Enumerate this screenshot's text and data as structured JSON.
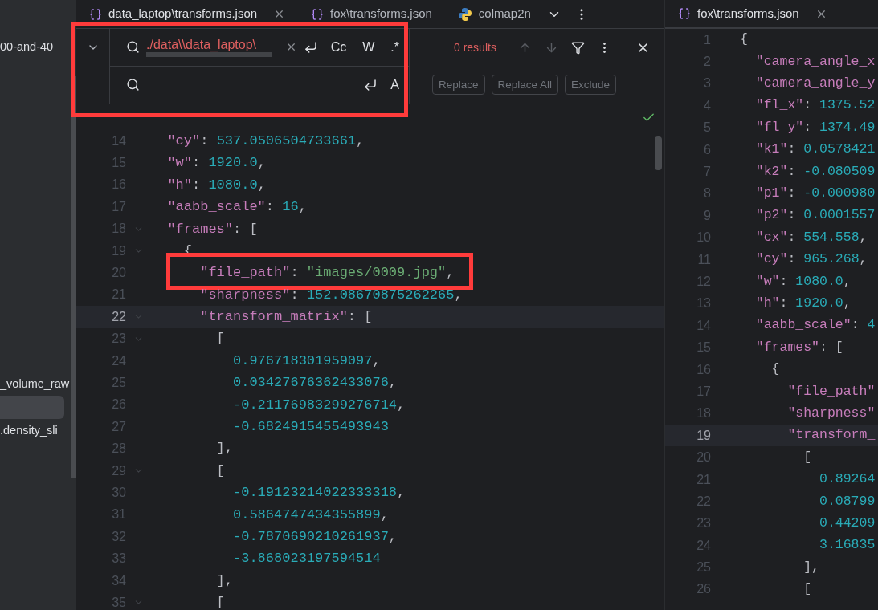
{
  "sidebar": {
    "items": [
      {
        "kind": "text",
        "text": "00-and-40",
        "selected": false
      },
      {
        "kind": "text",
        "text": "_volume_raw",
        "selected": false
      },
      {
        "kind": "blank",
        "selected": true
      },
      {
        "kind": "text",
        "text": ".density_sli",
        "selected": false
      }
    ]
  },
  "left_editor": {
    "tabs": [
      {
        "label": "data_laptop\\transforms.json",
        "kind": "json",
        "selected": true,
        "closable": true
      },
      {
        "label": "fox\\transforms.json",
        "kind": "json",
        "selected": false,
        "closable": false
      },
      {
        "label": "colmap2n",
        "kind": "python",
        "selected": false,
        "closable": false
      }
    ],
    "find_panel": {
      "highlighted": true,
      "expanded": false,
      "query": "./data\\\\data_laptop\\",
      "query_error": true,
      "toggles": [
        {
          "text": "Cc",
          "selected": false
        },
        {
          "text": "W",
          "selected": false
        },
        {
          "text": ".*",
          "selected": false
        }
      ],
      "result_count": "0 results",
      "result_error": true,
      "navigation_disabled": true,
      "replace_toggles": [
        {
          "text": "A",
          "selected": false
        }
      ],
      "buttons": [
        {
          "label": "Replace",
          "disabled": true
        },
        {
          "label": "Replace All",
          "disabled": true
        },
        {
          "label": "Exclude",
          "disabled": true
        }
      ]
    },
    "inspection_ok": true,
    "lines": [
      {
        "number": "14",
        "current": false,
        "fold": false,
        "highlighted": false,
        "tokens": [
          {
            "kind": "key",
            "text": "  \"cy\""
          },
          {
            "kind": "punct",
            "text": ": "
          },
          {
            "kind": "number",
            "text": "537.0506504733661"
          },
          {
            "kind": "punct",
            "text": ","
          }
        ]
      },
      {
        "number": "15",
        "current": false,
        "fold": false,
        "highlighted": false,
        "tokens": [
          {
            "kind": "key",
            "text": "  \"w\""
          },
          {
            "kind": "punct",
            "text": ": "
          },
          {
            "kind": "number",
            "text": "1920.0"
          },
          {
            "kind": "punct",
            "text": ","
          }
        ]
      },
      {
        "number": "16",
        "current": false,
        "fold": false,
        "highlighted": false,
        "tokens": [
          {
            "kind": "key",
            "text": "  \"h\""
          },
          {
            "kind": "punct",
            "text": ": "
          },
          {
            "kind": "number",
            "text": "1080.0"
          },
          {
            "kind": "punct",
            "text": ","
          }
        ]
      },
      {
        "number": "17",
        "current": false,
        "fold": false,
        "highlighted": false,
        "tokens": [
          {
            "kind": "key",
            "text": "  \"aabb_scale\""
          },
          {
            "kind": "punct",
            "text": ": "
          },
          {
            "kind": "number",
            "text": "16"
          },
          {
            "kind": "punct",
            "text": ","
          }
        ]
      },
      {
        "number": "18",
        "current": false,
        "fold": true,
        "highlighted": false,
        "tokens": [
          {
            "kind": "key",
            "text": "  \"frames\""
          },
          {
            "kind": "punct",
            "text": ": ["
          }
        ]
      },
      {
        "number": "19",
        "current": false,
        "fold": true,
        "highlighted": false,
        "tokens": [
          {
            "kind": "punct",
            "text": "    {"
          }
        ]
      },
      {
        "number": "20",
        "current": false,
        "fold": false,
        "highlighted": true,
        "tokens": [
          {
            "kind": "key",
            "text": "      \"file_path\""
          },
          {
            "kind": "punct",
            "text": ": "
          },
          {
            "kind": "string",
            "text": "\"images/0009.jpg\""
          },
          {
            "kind": "punct",
            "text": ","
          }
        ]
      },
      {
        "number": "21",
        "current": false,
        "fold": false,
        "highlighted": false,
        "tokens": [
          {
            "kind": "key",
            "text": "      \"sharpness\""
          },
          {
            "kind": "punct",
            "text": ": "
          },
          {
            "kind": "number",
            "text": "152.08670875262265"
          },
          {
            "kind": "punct",
            "text": ","
          }
        ]
      },
      {
        "number": "22",
        "current": true,
        "fold": true,
        "highlighted": false,
        "tokens": [
          {
            "kind": "key",
            "text": "      \"transform_matrix\""
          },
          {
            "kind": "punct",
            "text": ": ["
          }
        ]
      },
      {
        "number": "23",
        "current": false,
        "fold": true,
        "highlighted": false,
        "tokens": [
          {
            "kind": "punct",
            "text": "        ["
          }
        ]
      },
      {
        "number": "24",
        "current": false,
        "fold": false,
        "highlighted": false,
        "tokens": [
          {
            "kind": "number",
            "text": "          0.976718301959097"
          },
          {
            "kind": "punct",
            "text": ","
          }
        ]
      },
      {
        "number": "25",
        "current": false,
        "fold": false,
        "highlighted": false,
        "tokens": [
          {
            "kind": "number",
            "text": "          0.03427676362433076"
          },
          {
            "kind": "punct",
            "text": ","
          }
        ]
      },
      {
        "number": "26",
        "current": false,
        "fold": false,
        "highlighted": false,
        "tokens": [
          {
            "kind": "number",
            "text": "          -0.21176983299276714"
          },
          {
            "kind": "punct",
            "text": ","
          }
        ]
      },
      {
        "number": "27",
        "current": false,
        "fold": false,
        "highlighted": false,
        "tokens": [
          {
            "kind": "number",
            "text": "          -0.6824915455493943"
          }
        ]
      },
      {
        "number": "28",
        "current": false,
        "fold": false,
        "highlighted": false,
        "tokens": [
          {
            "kind": "punct",
            "text": "        ],"
          }
        ]
      },
      {
        "number": "29",
        "current": false,
        "fold": true,
        "highlighted": false,
        "tokens": [
          {
            "kind": "punct",
            "text": "        ["
          }
        ]
      },
      {
        "number": "30",
        "current": false,
        "fold": false,
        "highlighted": false,
        "tokens": [
          {
            "kind": "number",
            "text": "          -0.19123214022333318"
          },
          {
            "kind": "punct",
            "text": ","
          }
        ]
      },
      {
        "number": "31",
        "current": false,
        "fold": false,
        "highlighted": false,
        "tokens": [
          {
            "kind": "number",
            "text": "          0.5864747434355899"
          },
          {
            "kind": "punct",
            "text": ","
          }
        ]
      },
      {
        "number": "32",
        "current": false,
        "fold": false,
        "highlighted": false,
        "tokens": [
          {
            "kind": "number",
            "text": "          -0.7870690210261937"
          },
          {
            "kind": "punct",
            "text": ","
          }
        ]
      },
      {
        "number": "33",
        "current": false,
        "fold": false,
        "highlighted": false,
        "tokens": [
          {
            "kind": "number",
            "text": "          -3.868023197594514"
          }
        ]
      },
      {
        "number": "34",
        "current": false,
        "fold": false,
        "highlighted": false,
        "tokens": [
          {
            "kind": "punct",
            "text": "        ],"
          }
        ]
      },
      {
        "number": "35",
        "current": false,
        "fold": true,
        "highlighted": false,
        "tokens": [
          {
            "kind": "punct",
            "text": "        ["
          }
        ]
      }
    ]
  },
  "right_editor": {
    "tabs": [
      {
        "label": "fox\\transforms.json",
        "kind": "json",
        "selected": true,
        "closable": true
      }
    ],
    "lines": [
      {
        "number": "1",
        "current": false,
        "tokens": [
          {
            "kind": "punct",
            "text": "{"
          }
        ]
      },
      {
        "number": "2",
        "current": false,
        "tokens": [
          {
            "kind": "key",
            "text": "  \"camera_angle_x"
          }
        ]
      },
      {
        "number": "3",
        "current": false,
        "tokens": [
          {
            "kind": "key",
            "text": "  \"camera_angle_y"
          }
        ]
      },
      {
        "number": "4",
        "current": false,
        "tokens": [
          {
            "kind": "key",
            "text": "  \"fl_x\""
          },
          {
            "kind": "punct",
            "text": ": "
          },
          {
            "kind": "number",
            "text": "1375.52"
          }
        ]
      },
      {
        "number": "5",
        "current": false,
        "tokens": [
          {
            "kind": "key",
            "text": "  \"fl_y\""
          },
          {
            "kind": "punct",
            "text": ": "
          },
          {
            "kind": "number",
            "text": "1374.49"
          }
        ]
      },
      {
        "number": "6",
        "current": false,
        "tokens": [
          {
            "kind": "key",
            "text": "  \"k1\""
          },
          {
            "kind": "punct",
            "text": ": "
          },
          {
            "kind": "number",
            "text": "0.0578421"
          }
        ]
      },
      {
        "number": "7",
        "current": false,
        "tokens": [
          {
            "kind": "key",
            "text": "  \"k2\""
          },
          {
            "kind": "punct",
            "text": ": "
          },
          {
            "kind": "number",
            "text": "-0.080509"
          }
        ]
      },
      {
        "number": "8",
        "current": false,
        "tokens": [
          {
            "kind": "key",
            "text": "  \"p1\""
          },
          {
            "kind": "punct",
            "text": ": "
          },
          {
            "kind": "number",
            "text": "-0.000980"
          }
        ]
      },
      {
        "number": "9",
        "current": false,
        "tokens": [
          {
            "kind": "key",
            "text": "  \"p2\""
          },
          {
            "kind": "punct",
            "text": ": "
          },
          {
            "kind": "number",
            "text": "0.0001557"
          }
        ]
      },
      {
        "number": "10",
        "current": false,
        "tokens": [
          {
            "kind": "key",
            "text": "  \"cx\""
          },
          {
            "kind": "punct",
            "text": ": "
          },
          {
            "kind": "number",
            "text": "554.558"
          },
          {
            "kind": "punct",
            "text": ","
          }
        ]
      },
      {
        "number": "11",
        "current": false,
        "tokens": [
          {
            "kind": "key",
            "text": "  \"cy\""
          },
          {
            "kind": "punct",
            "text": ": "
          },
          {
            "kind": "number",
            "text": "965.268"
          },
          {
            "kind": "punct",
            "text": ","
          }
        ]
      },
      {
        "number": "12",
        "current": false,
        "tokens": [
          {
            "kind": "key",
            "text": "  \"w\""
          },
          {
            "kind": "punct",
            "text": ": "
          },
          {
            "kind": "number",
            "text": "1080.0"
          },
          {
            "kind": "punct",
            "text": ","
          }
        ]
      },
      {
        "number": "13",
        "current": false,
        "tokens": [
          {
            "kind": "key",
            "text": "  \"h\""
          },
          {
            "kind": "punct",
            "text": ": "
          },
          {
            "kind": "number",
            "text": "1920.0"
          },
          {
            "kind": "punct",
            "text": ","
          }
        ]
      },
      {
        "number": "14",
        "current": false,
        "tokens": [
          {
            "kind": "key",
            "text": "  \"aabb_scale\""
          },
          {
            "kind": "punct",
            "text": ": "
          },
          {
            "kind": "number",
            "text": "4"
          }
        ]
      },
      {
        "number": "15",
        "current": false,
        "tokens": [
          {
            "kind": "key",
            "text": "  \"frames\""
          },
          {
            "kind": "punct",
            "text": ": ["
          }
        ]
      },
      {
        "number": "16",
        "current": false,
        "tokens": [
          {
            "kind": "punct",
            "text": "    {"
          }
        ]
      },
      {
        "number": "17",
        "current": false,
        "tokens": [
          {
            "kind": "key",
            "text": "      \"file_path\""
          }
        ]
      },
      {
        "number": "18",
        "current": false,
        "tokens": [
          {
            "kind": "key",
            "text": "      \"sharpness\""
          }
        ]
      },
      {
        "number": "19",
        "current": true,
        "tokens": [
          {
            "kind": "key",
            "text": "      \"transform_"
          }
        ]
      },
      {
        "number": "20",
        "current": false,
        "tokens": [
          {
            "kind": "punct",
            "text": "        ["
          }
        ]
      },
      {
        "number": "21",
        "current": false,
        "tokens": [
          {
            "kind": "number",
            "text": "          0.89264"
          }
        ]
      },
      {
        "number": "22",
        "current": false,
        "tokens": [
          {
            "kind": "number",
            "text": "          0.08799"
          }
        ]
      },
      {
        "number": "23",
        "current": false,
        "tokens": [
          {
            "kind": "number",
            "text": "          0.44209"
          }
        ]
      },
      {
        "number": "24",
        "current": false,
        "tokens": [
          {
            "kind": "number",
            "text": "          3.16835"
          }
        ]
      },
      {
        "number": "25",
        "current": false,
        "tokens": [
          {
            "kind": "punct",
            "text": "        ],"
          }
        ]
      },
      {
        "number": "26",
        "current": false,
        "tokens": [
          {
            "kind": "punct",
            "text": "        ["
          }
        ]
      }
    ]
  }
}
